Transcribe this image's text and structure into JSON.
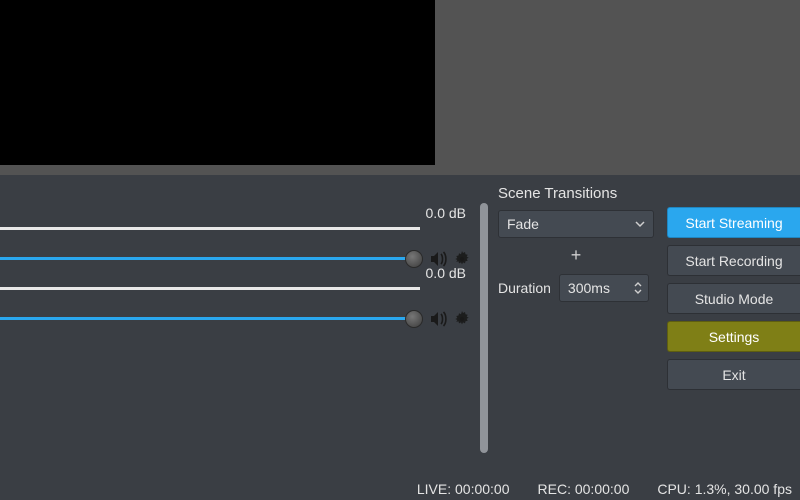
{
  "mixer": {
    "channels": [
      {
        "db": "0.0 dB"
      },
      {
        "db": "0.0 dB"
      }
    ]
  },
  "transitions": {
    "title": "Scene Transitions",
    "selected": "Fade",
    "duration_label": "Duration",
    "duration_value": "300ms"
  },
  "buttons": {
    "start_streaming": "Start Streaming",
    "start_recording": "Start Recording",
    "studio_mode": "Studio Mode",
    "settings": "Settings",
    "exit": "Exit"
  },
  "status": {
    "live": "LIVE: 00:00:00",
    "rec": "REC: 00:00:00",
    "cpu": "CPU: 1.3%, 30.00 fps"
  }
}
